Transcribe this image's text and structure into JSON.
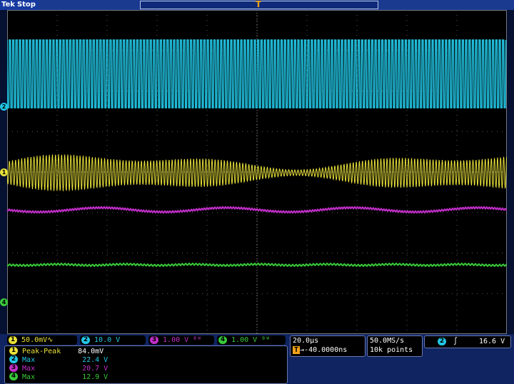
{
  "header": {
    "brand": "Tek",
    "state": "Stop"
  },
  "trigger_marker": "T",
  "channels": [
    {
      "id": "1",
      "color": "#e8e13a",
      "scale": "50.0mV",
      "coupling_icon": "ac-coupling-icon"
    },
    {
      "id": "2",
      "color": "#22c7e6",
      "scale": "10.0 V"
    },
    {
      "id": "3",
      "color": "#c22fc9",
      "scale": "1.00 V"
    },
    {
      "id": "4",
      "color": "#39c93a",
      "scale": "1.00 V"
    }
  ],
  "ac_glyph": "∿",
  "bw_glyph": "ᴮᵂ",
  "measurements": [
    {
      "ch": "1",
      "label": "Peak-Peak",
      "value": "84.0mV",
      "color": "#e8e13a"
    },
    {
      "ch": "2",
      "label": "Max",
      "value": "22.4 V",
      "color": "#22c7e6"
    },
    {
      "ch": "3",
      "label": "Max",
      "value": "20.7 V",
      "color": "#c22fc9"
    },
    {
      "ch": "4",
      "label": "Max",
      "value": "12.9 V",
      "color": "#39c93a"
    }
  ],
  "timebase": {
    "scale": "20.0µs",
    "position": "→-40.0000ns",
    "trig_icon": "T"
  },
  "acquisition": {
    "rate": "50.0MS/s",
    "points": "10k points"
  },
  "trigger": {
    "source": "2",
    "slope": "∫",
    "level": "16.6 V"
  },
  "colors": {
    "background": "#000000",
    "frame": "#061030",
    "bar": "#0f2461",
    "grid": "#5a5a5a"
  }
}
